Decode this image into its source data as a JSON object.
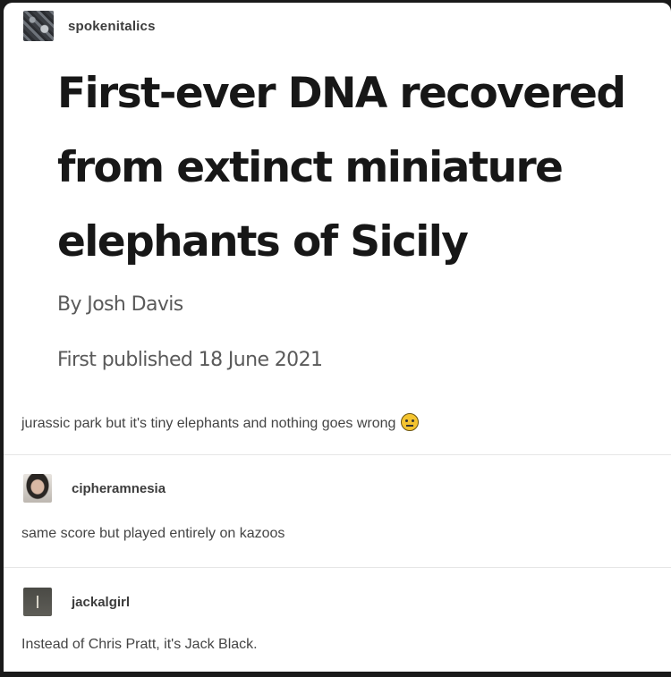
{
  "post": {
    "author": "spokenitalics",
    "article": {
      "headline_lines": [
        "First-ever DNA recovered",
        "from extinct miniature",
        "elephants of Sicily"
      ],
      "byline": "By Josh Davis",
      "published": "First published 18 June 2021"
    },
    "caption": "jurassic park but it's tiny elephants and nothing goes wrong",
    "caption_emoji": "frowning-face-emoji"
  },
  "replies": [
    {
      "author": "cipheramnesia",
      "text": "same score but played entirely on kazoos"
    },
    {
      "author": "jackalgirl",
      "text": "Instead of Chris Pratt, it's Jack Black."
    }
  ]
}
